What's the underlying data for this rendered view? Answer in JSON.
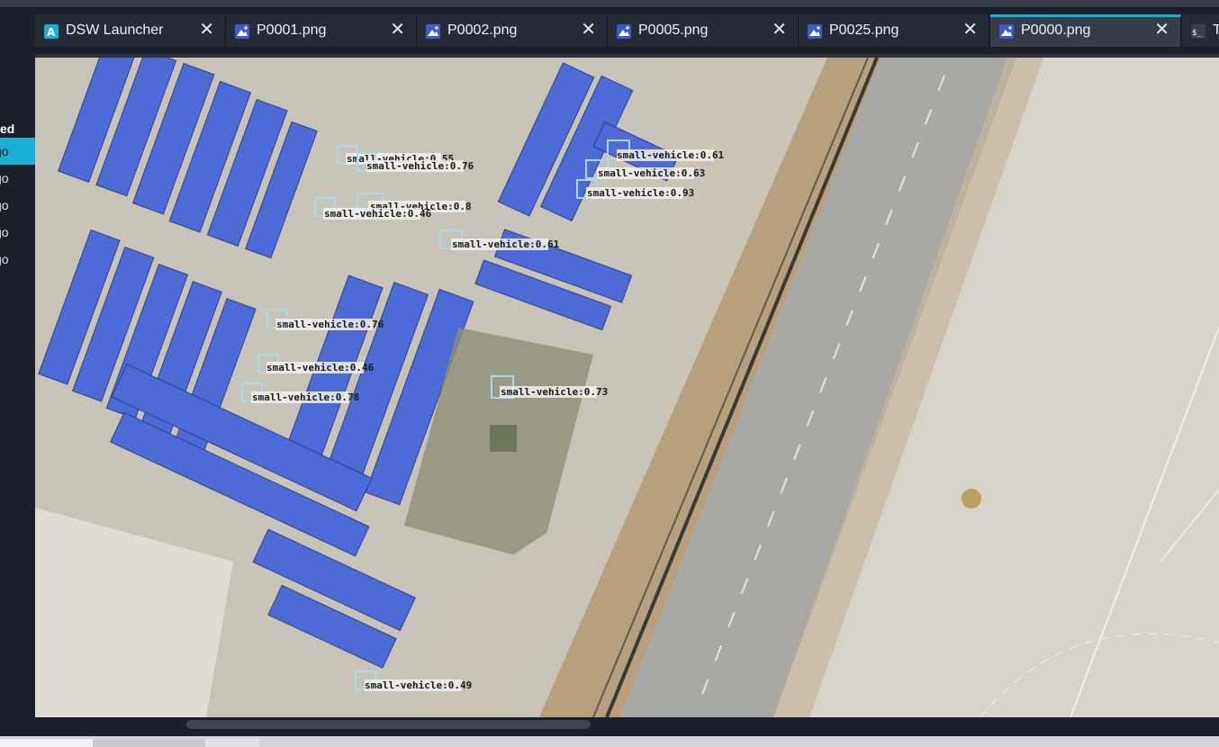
{
  "sidebar": {
    "header": "ed",
    "rows": [
      "go",
      "go",
      "go",
      "go",
      "go"
    ]
  },
  "tabs": [
    {
      "label": "DSW Launcher",
      "icon": "launcher-icon",
      "active": false
    },
    {
      "label": "P0001.png",
      "icon": "image-icon",
      "active": false
    },
    {
      "label": "P0002.png",
      "icon": "image-icon",
      "active": false
    },
    {
      "label": "P0005.png",
      "icon": "image-icon",
      "active": false
    },
    {
      "label": "P0025.png",
      "icon": "image-icon",
      "active": false
    },
    {
      "label": "P0000.png",
      "icon": "image-icon",
      "active": true
    },
    {
      "label": "T",
      "icon": "terminal-icon",
      "active": false
    }
  ],
  "tab_close_glyph": "✕",
  "detections": [
    {
      "text": "small-vehicle:0.55"
    },
    {
      "text": "small-vehicle:0.76"
    },
    {
      "text": "small-vehicle:0.8"
    },
    {
      "text": "small-vehicle:0.46"
    },
    {
      "text": "small-vehicle:0.61"
    },
    {
      "text": "small-vehicle:0.63"
    },
    {
      "text": "small-vehicle:0.93"
    },
    {
      "text": "small-vehicle:0.61"
    },
    {
      "text": "small-vehicle:0.76"
    },
    {
      "text": "small-vehicle:0.46"
    },
    {
      "text": "small-vehicle:0.78"
    },
    {
      "text": "small-vehicle:0.73"
    },
    {
      "text": "small-vehicle:0.49"
    }
  ],
  "colors": {
    "accent": "#17b0d2",
    "roof_blue": "#4d6bd6",
    "runway": "#d6d3cb"
  }
}
